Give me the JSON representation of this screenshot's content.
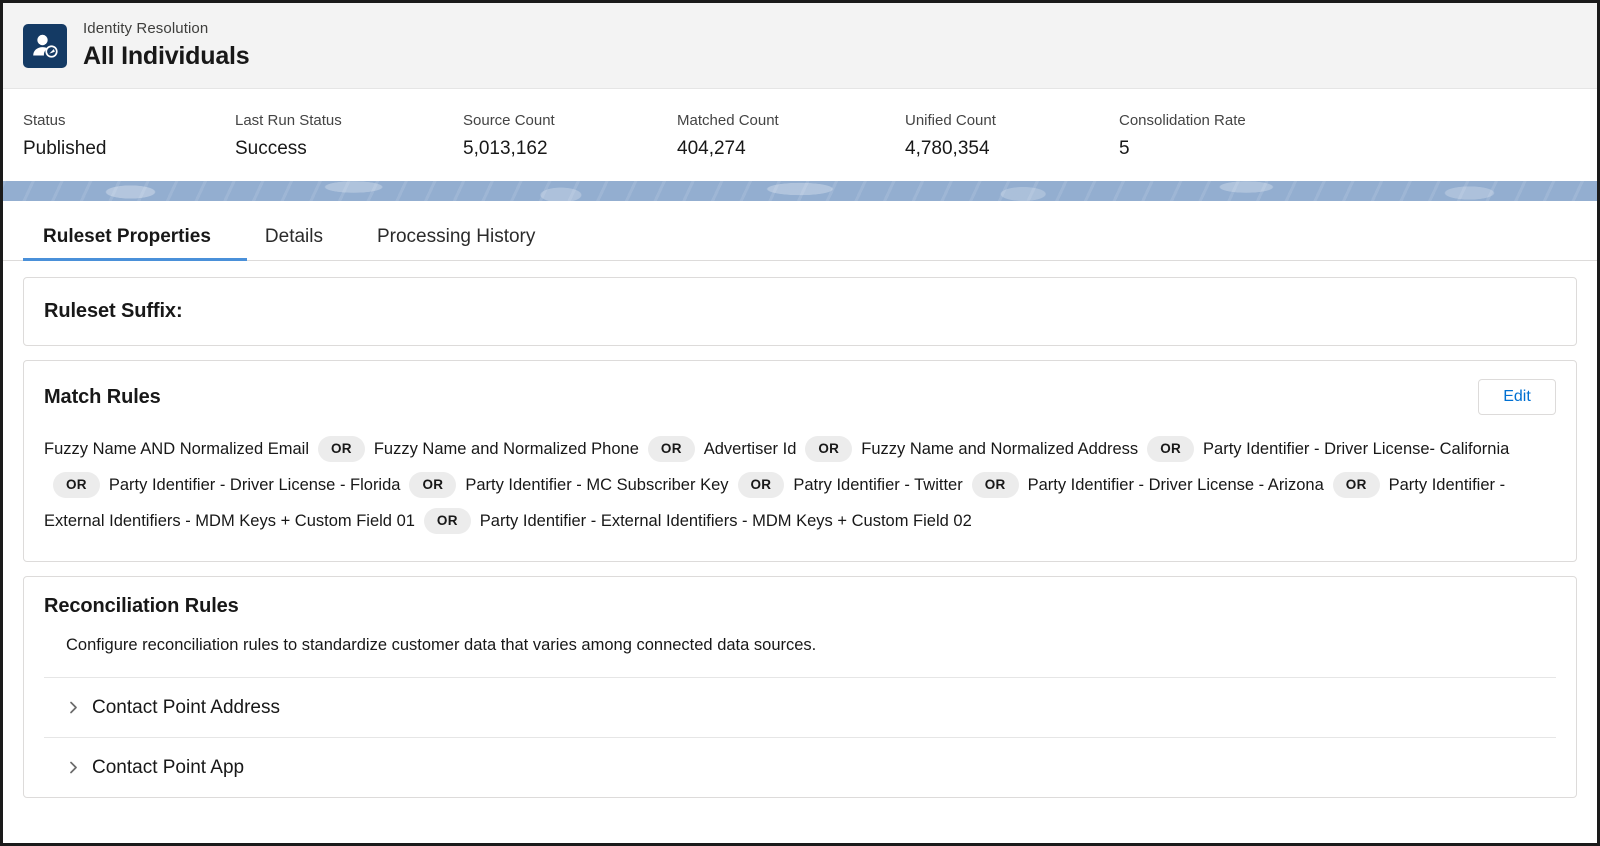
{
  "header": {
    "eyebrow": "Identity Resolution",
    "title": "All Individuals",
    "app_icon": "identity-person-badge-icon"
  },
  "stats": [
    {
      "label": "Status",
      "value": "Published"
    },
    {
      "label": "Last Run Status",
      "value": "Success"
    },
    {
      "label": "Source Count",
      "value": "5,013,162"
    },
    {
      "label": "Matched Count",
      "value": "404,274"
    },
    {
      "label": "Unified Count",
      "value": "4,780,354"
    },
    {
      "label": "Consolidation Rate",
      "value": "5"
    }
  ],
  "tabs": [
    {
      "label": "Ruleset Properties",
      "active": true
    },
    {
      "label": "Details",
      "active": false
    },
    {
      "label": "Processing History",
      "active": false
    }
  ],
  "ruleset_suffix": {
    "title": "Ruleset Suffix:",
    "value": ""
  },
  "match_rules": {
    "title": "Match Rules",
    "edit_label": "Edit",
    "separator": "OR",
    "rules": [
      "Fuzzy Name AND Normalized Email",
      "Fuzzy Name and Normalized Phone",
      "Advertiser Id",
      "Fuzzy Name and Normalized Address",
      "Party Identifier - Driver License- California",
      "Party Identifier - Driver License - Florida",
      "Party Identifier - MC Subscriber Key",
      "Patry Identifier - Twitter",
      "Party Identifier - Driver License - Arizona",
      "Party Identifier - External Identifiers - MDM Keys + Custom Field 01",
      "Party Identifier - External Identifiers - MDM Keys + Custom Field 02"
    ]
  },
  "reconciliation_rules": {
    "title": "Reconciliation Rules",
    "description": "Configure reconciliation rules to standardize customer data that varies among connected data sources.",
    "sections": [
      {
        "label": "Contact Point Address",
        "expanded": false,
        "icon": "chevron-right-icon"
      },
      {
        "label": "Contact Point App",
        "expanded": false,
        "icon": "chevron-right-icon"
      }
    ]
  },
  "colors": {
    "accent_blue": "#0070d2",
    "tab_underline": "#4a90d9",
    "app_icon_bg": "#143a64",
    "band": "#93aed0",
    "chip_bg": "#ececec"
  }
}
